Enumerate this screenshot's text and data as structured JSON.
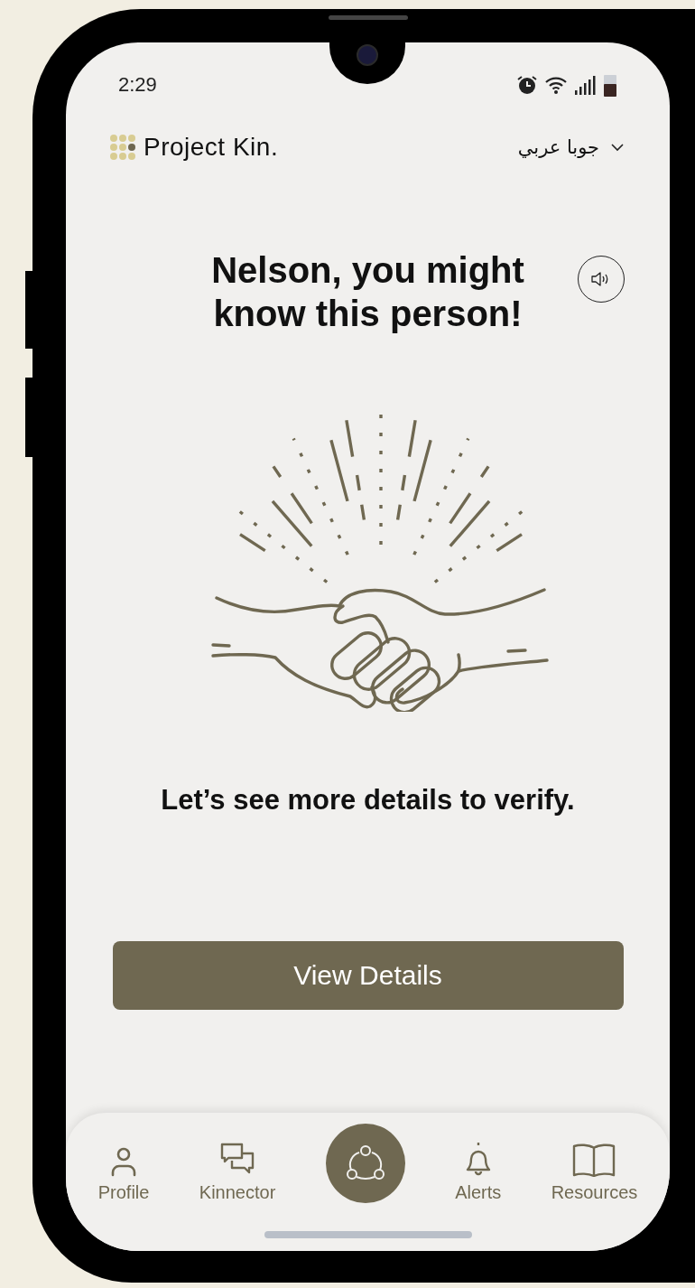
{
  "status_bar": {
    "time": "2:29"
  },
  "header": {
    "brand": "Project Kin.",
    "language": "جوبا عربي"
  },
  "title": "Nelson, you might know this person!",
  "subtitle": "Let’s see more details to verify.",
  "primary_button": "View Details",
  "nav": [
    {
      "kind": "tab",
      "label": "Profile"
    },
    {
      "kind": "tab",
      "label": "Kinnector"
    },
    {
      "kind": "center"
    },
    {
      "kind": "tab",
      "label": "Alerts"
    },
    {
      "kind": "tab",
      "label": "Resources"
    }
  ]
}
